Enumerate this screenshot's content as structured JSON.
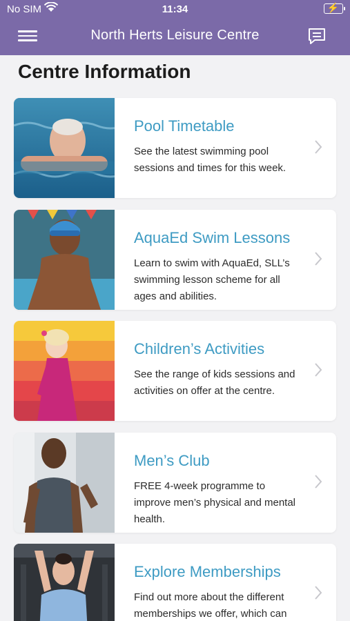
{
  "status": {
    "carrier": "No SIM",
    "time": "11:34",
    "battery_glyph": "⚡"
  },
  "header": {
    "title": "North Herts Leisure Centre",
    "menu_icon": "hamburger-menu-icon",
    "chat_icon": "message-icon"
  },
  "page": {
    "title": "Centre Information"
  },
  "cards": [
    {
      "title": "Pool Timetable",
      "desc": "See the latest swimming pool sessions and times for this week."
    },
    {
      "title": "AquaEd Swim Lessons",
      "desc": "Learn to swim with AquaEd, SLL’s swimming lesson scheme for all ages and abilities."
    },
    {
      "title": "Children’s Activities",
      "desc": "See the range of kids sessions and activities on offer at the centre."
    },
    {
      "title": "Men’s Club",
      "desc": "FREE 4-week programme to improve men’s physical and mental health."
    },
    {
      "title": "Explore Memberships",
      "desc": "Find out more about the different memberships we offer, which can include a range of activities."
    }
  ],
  "colors": {
    "header": "#7b6aa8",
    "accent": "#3e9bc3",
    "background": "#f2f2f4"
  }
}
